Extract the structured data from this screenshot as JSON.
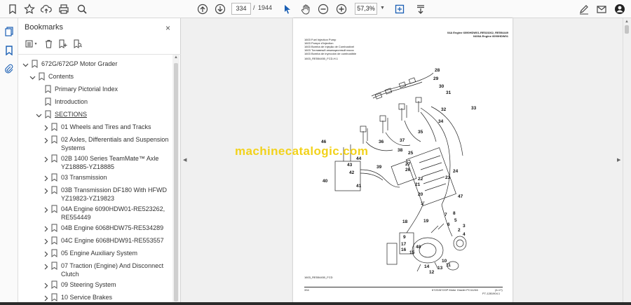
{
  "toolbar": {
    "current_page": "334",
    "page_separator": "/",
    "total_pages": "1944",
    "zoom": "57,3%"
  },
  "rail": {
    "icons": [
      "pages-icon",
      "bookmark-icon",
      "attachment-icon"
    ]
  },
  "bookmarks": {
    "title": "Bookmarks",
    "close": "×",
    "items": [
      {
        "label": "672G/672GP Motor Grader"
      },
      {
        "label": "Contents"
      },
      {
        "label": "Primary Pictorial Index"
      },
      {
        "label": "Introduction"
      },
      {
        "label": "SECTIONS"
      },
      {
        "label": "01 Wheels and Tires and Tracks"
      },
      {
        "label": "02 Axles, Differentials and Suspension Systems"
      },
      {
        "label": "02B 1400 Series TeamMate™ Axle YZ18885-YZ18885"
      },
      {
        "label": "03 Transmission"
      },
      {
        "label": "03B Transmission DF180 With HFWD YZ19823-YZ19823"
      },
      {
        "label": "04A Engine 6090HDW01-RE523262, RE554449"
      },
      {
        "label": "04B Engine 6068HDW75-RE534289"
      },
      {
        "label": "04C Engine 6068HDW91-RE553557"
      },
      {
        "label": "05 Engine Auxiliary System"
      },
      {
        "label": "07 Traction (Engine) And Disconnect Clutch"
      },
      {
        "label": "09 Steering System"
      },
      {
        "label": "10 Service Brakes"
      }
    ]
  },
  "document": {
    "header_line1": "04A Engine 6090HDW01-RE523262, RE554449",
    "header_line2": "0406A Engine 6090HDW01",
    "title_lines": [
      "1603 Fuel Injection Pump",
      "1603 Pompe d'injection",
      "1603 Bomba de Injeção de Combustível",
      "1603 Топливный инжекционный насос",
      "1603 Bomba de inyección de combustible"
    ],
    "ref_code": "1603_RE554450_FCD-H.1",
    "figure_ref": "1603_RE554450_FCD",
    "footer_page": "334",
    "footer_title": "672G/672GP Motor Grader   PC11246",
    "footer_date": "(4-17)",
    "footer_code": "P7-1281904.1",
    "watermark": "machinecatalogic.com",
    "part_numbers": [
      "28",
      "29",
      "30",
      "31",
      "33",
      "32",
      "34",
      "35",
      "46",
      "37",
      "36",
      "38",
      "44",
      "43",
      "39",
      "42",
      "40",
      "41",
      "25",
      "26",
      "27",
      "24",
      "23",
      "22",
      "21",
      "20",
      "1",
      "47",
      "8",
      "18",
      "19",
      "7",
      "5",
      "6",
      "3",
      "2",
      "4",
      "9",
      "17",
      "16",
      "15",
      "48",
      "14",
      "13",
      "12",
      "10",
      "11"
    ]
  }
}
